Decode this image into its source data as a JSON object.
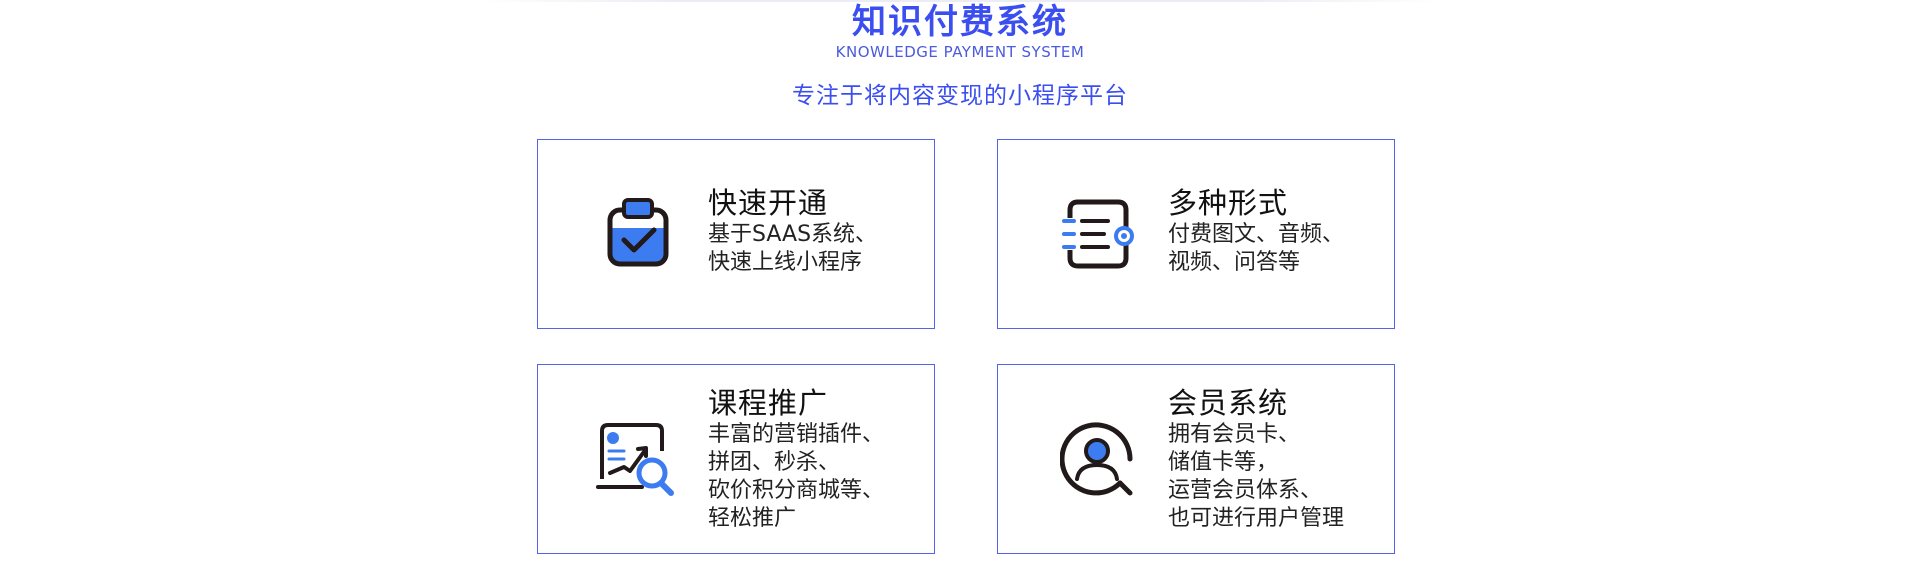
{
  "header": {
    "title": "知识付费系统",
    "subtitle_en": "KNOWLEDGE PAYMENT SYSTEM",
    "tagline": "专注于将内容变现的小程序平台"
  },
  "colors": {
    "brand_blue": "#3b4ef0",
    "card_border": "#5563e8",
    "icon_blue": "#3d7cf0",
    "icon_dark": "#221a1a"
  },
  "features": [
    {
      "icon": "clipboard-check-icon",
      "title": "快速开通",
      "desc": [
        "基于SAAS系统、",
        "快速上线小程序"
      ]
    },
    {
      "icon": "list-location-icon",
      "title": "多种形式",
      "desc": [
        "付费图文、音频、",
        "视频、问答等"
      ]
    },
    {
      "icon": "growth-analytics-icon",
      "title": "课程推广",
      "desc": [
        "丰富的营销插件、",
        "拼团、秒杀、",
        "砍价积分商城等、",
        "轻松推广"
      ]
    },
    {
      "icon": "member-user-icon",
      "title": "会员系统",
      "desc": [
        "拥有会员卡、",
        "储值卡等，",
        "运营会员体系、",
        "也可进行用户管理"
      ]
    }
  ]
}
